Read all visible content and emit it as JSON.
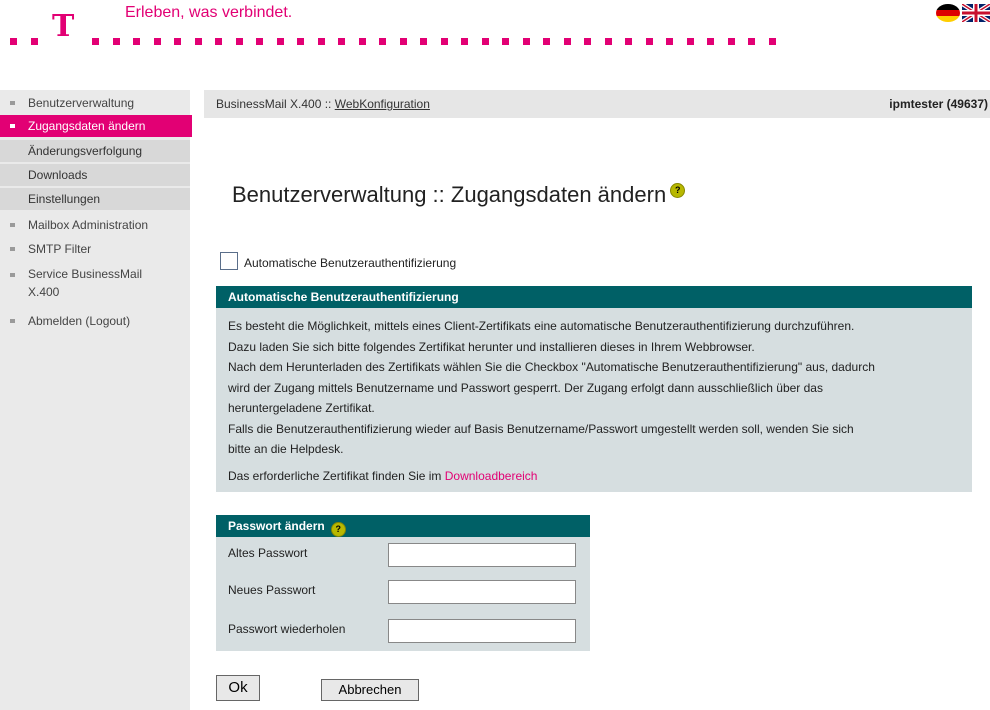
{
  "header": {
    "logo_letter": "T",
    "slogan": "Erleben, was verbindet.",
    "flags": [
      "de-flag-icon",
      "uk-flag-icon"
    ],
    "brand_color": "#e20074"
  },
  "sidebar": {
    "items": [
      {
        "label": "Benutzerverwaltung"
      },
      {
        "label": "Zugangsdaten ändern"
      },
      {
        "label": "Änderungsverfolgung"
      },
      {
        "label": "Downloads"
      },
      {
        "label": "Einstellungen"
      },
      {
        "label": "Mailbox Administration"
      },
      {
        "label": "SMTP Filter"
      },
      {
        "label": "Service BusinessMail"
      },
      {
        "label": "X.400"
      },
      {
        "label": "Abmelden (Logout)"
      }
    ]
  },
  "breadcrumb": {
    "root": "BusinessMail X.400 :: ",
    "link": "WebKonfiguration",
    "user": "ipmtester (49637)"
  },
  "page": {
    "title": "Benutzerverwaltung :: Zugangsdaten ändern",
    "help_glyph": "?"
  },
  "auto_auth": {
    "checkbox_label": "Automatische Benutzerauthentifizierung",
    "checked": false,
    "panel_title": "Automatische Benutzerauthentifizierung",
    "lines": [
      "Es besteht die Möglichkeit, mittels eines Client-Zertifikats eine automatische Benutzerauthentifizierung durchzuführen.",
      "Dazu laden Sie sich bitte folgendes Zertifikat herunter und installieren dieses in Ihrem Webbrowser.",
      "Nach dem Herunterladen des Zertifikats wählen Sie die Checkbox \"Automatische Benutzerauthentifizierung\" aus, dadurch",
      "wird der Zugang mittels Benutzername und Passwort gesperrt. Der Zugang erfolgt dann ausschließlich über das",
      "heruntergeladene Zertifikat.",
      "Falls die Benutzerauthentifizierung wieder auf Basis Benutzername/Passwort umgestellt werden soll, wenden Sie sich",
      "bitte an die Helpdesk."
    ],
    "download_text": "Das erforderliche Zertifikat finden Sie im ",
    "download_link": "Downloadbereich"
  },
  "password": {
    "panel_title": "Passwort ändern",
    "old_label": "Altes Passwort",
    "new_label": "Neues Passwort",
    "repeat_label": "Passwort wiederholen",
    "old_value": "",
    "new_value": "",
    "repeat_value": ""
  },
  "buttons": {
    "ok": "Ok",
    "cancel": "Abbrechen"
  }
}
